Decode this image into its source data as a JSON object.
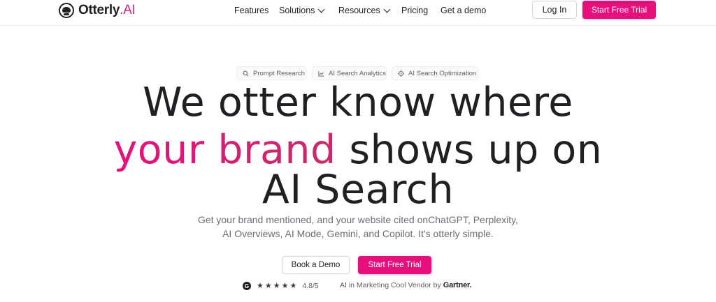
{
  "brand": {
    "name": "Otterly",
    "suffix": ".AI"
  },
  "nav": {
    "features": "Features",
    "solutions": "Solutions",
    "resources": "Resources",
    "pricing": "Pricing",
    "demo": "Get a demo"
  },
  "header": {
    "login": "Log In",
    "trial": "Start Free Trial"
  },
  "pills": [
    {
      "label": "Prompt Research",
      "icon": "search-icon"
    },
    {
      "label": "AI Search Analytics",
      "icon": "chart-icon"
    },
    {
      "label": "AI Search Optimization",
      "icon": "target-icon"
    }
  ],
  "hero": {
    "line1": "We otter know where",
    "line2_accent": "your brand",
    "line2_rest": " shows up on",
    "line3": "AI Search",
    "sub1": "Get your brand mentioned, and your website cited onChatGPT, Perplexity,",
    "sub2": "AI Overviews, AI Mode, Gemini, and Copilot. It's otterly simple."
  },
  "cta": {
    "demo": "Book a Demo",
    "trial": "Start Free Trial"
  },
  "rating": {
    "g2_badge": "G",
    "stars": 5,
    "score": "4.8/5",
    "vendor_text": "AI in Marketing Cool Vendor by",
    "vendor_brand": "Gartner."
  },
  "colors": {
    "accent": "#e6107c",
    "text": "#1f2023",
    "muted": "#6b6d73"
  }
}
